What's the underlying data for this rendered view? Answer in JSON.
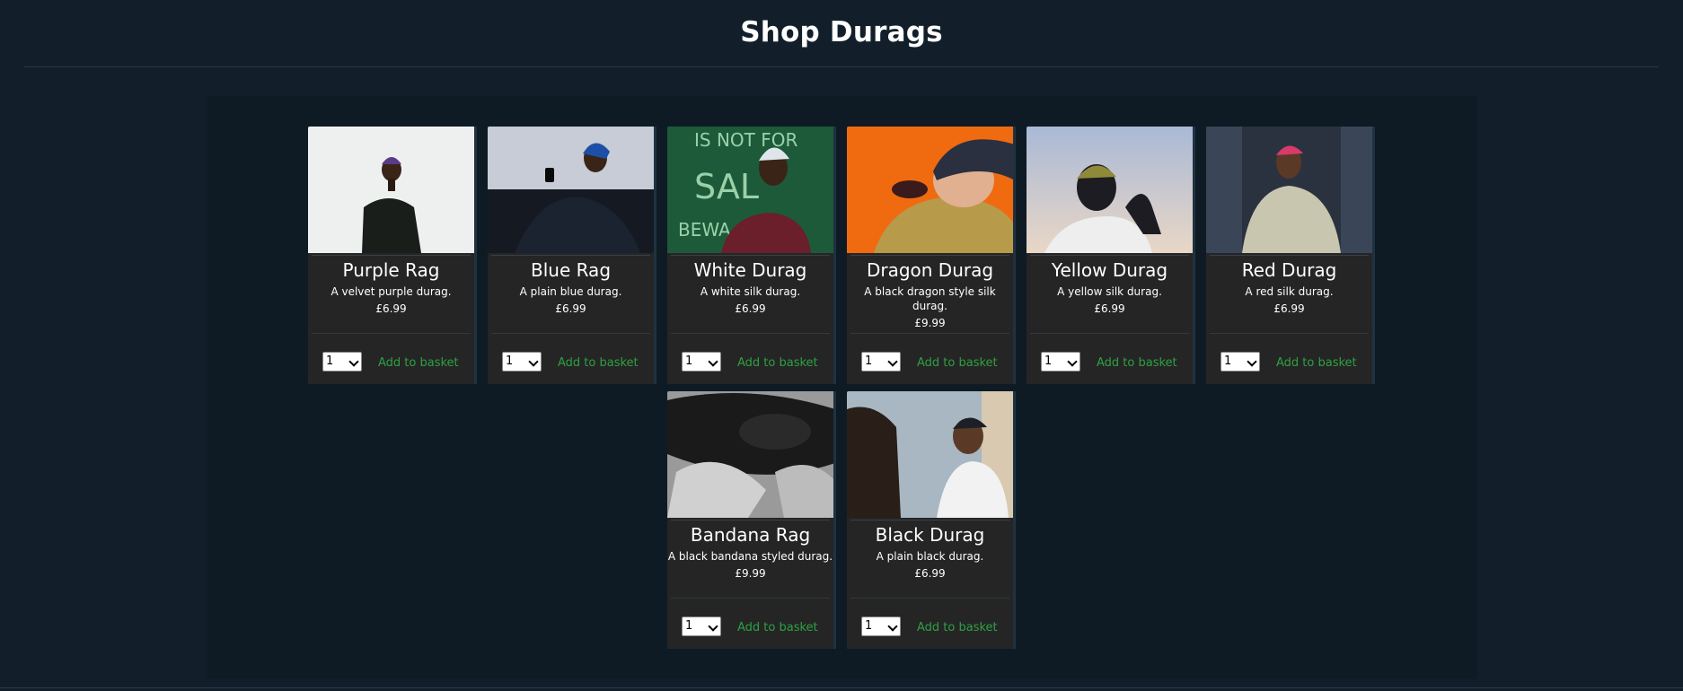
{
  "header": {
    "title": "Shop Durags"
  },
  "products": [
    {
      "name": "Purple Rag",
      "description": "A velvet purple durag.",
      "price": "£6.99",
      "qty": "1",
      "cta": "Add to basket",
      "image": "person-purple-durag",
      "colors": [
        "#eef0f0",
        "#5a3b8a",
        "#1a1e1a"
      ]
    },
    {
      "name": "Blue Rag",
      "description": "A plain blue durag.",
      "price": "£6.99",
      "qty": "1",
      "cta": "Add to basket",
      "image": "person-blue-durag",
      "colors": [
        "#c7ccd6",
        "#1e4fa8",
        "#1b2230"
      ]
    },
    {
      "name": "White Durag",
      "description": "A white silk durag.",
      "price": "£6.99",
      "qty": "1",
      "cta": "Add to basket",
      "image": "person-white-durag",
      "colors": [
        "#1d5a3a",
        "#dfe6ea",
        "#6a1f2a"
      ]
    },
    {
      "name": "Dragon Durag",
      "description": "A black dragon style silk durag.",
      "price": "£9.99",
      "qty": "1",
      "cta": "Add to basket",
      "image": "person-dragon-durag",
      "colors": [
        "#f06a10",
        "#b79a4a",
        "#2a3040"
      ]
    },
    {
      "name": "Yellow Durag",
      "description": "A yellow silk durag.",
      "price": "£6.99",
      "qty": "1",
      "cta": "Add to basket",
      "image": "person-yellow-durag",
      "colors": [
        "#b9c6de",
        "#8e8a3a",
        "#1c1c22"
      ]
    },
    {
      "name": "Red Durag",
      "description": "A red silk durag.",
      "price": "£6.99",
      "qty": "1",
      "cta": "Add to basket",
      "image": "person-red-durag",
      "colors": [
        "#2a3240",
        "#d83a6a",
        "#c9c6b0"
      ]
    },
    {
      "name": "Bandana Rag",
      "description": "A black bandana styled durag.",
      "price": "£9.99",
      "qty": "1",
      "cta": "Add to basket",
      "image": "hands-bandana",
      "colors": [
        "#9a9a9a",
        "#1a1a1a",
        "#d0d0d0"
      ]
    },
    {
      "name": "Black Durag",
      "description": "A plain black durag.",
      "price": "£6.99",
      "qty": "1",
      "cta": "Add to basket",
      "image": "people-black-durag",
      "colors": [
        "#a8b7c2",
        "#1c1f26",
        "#f2f2f2"
      ]
    }
  ]
}
